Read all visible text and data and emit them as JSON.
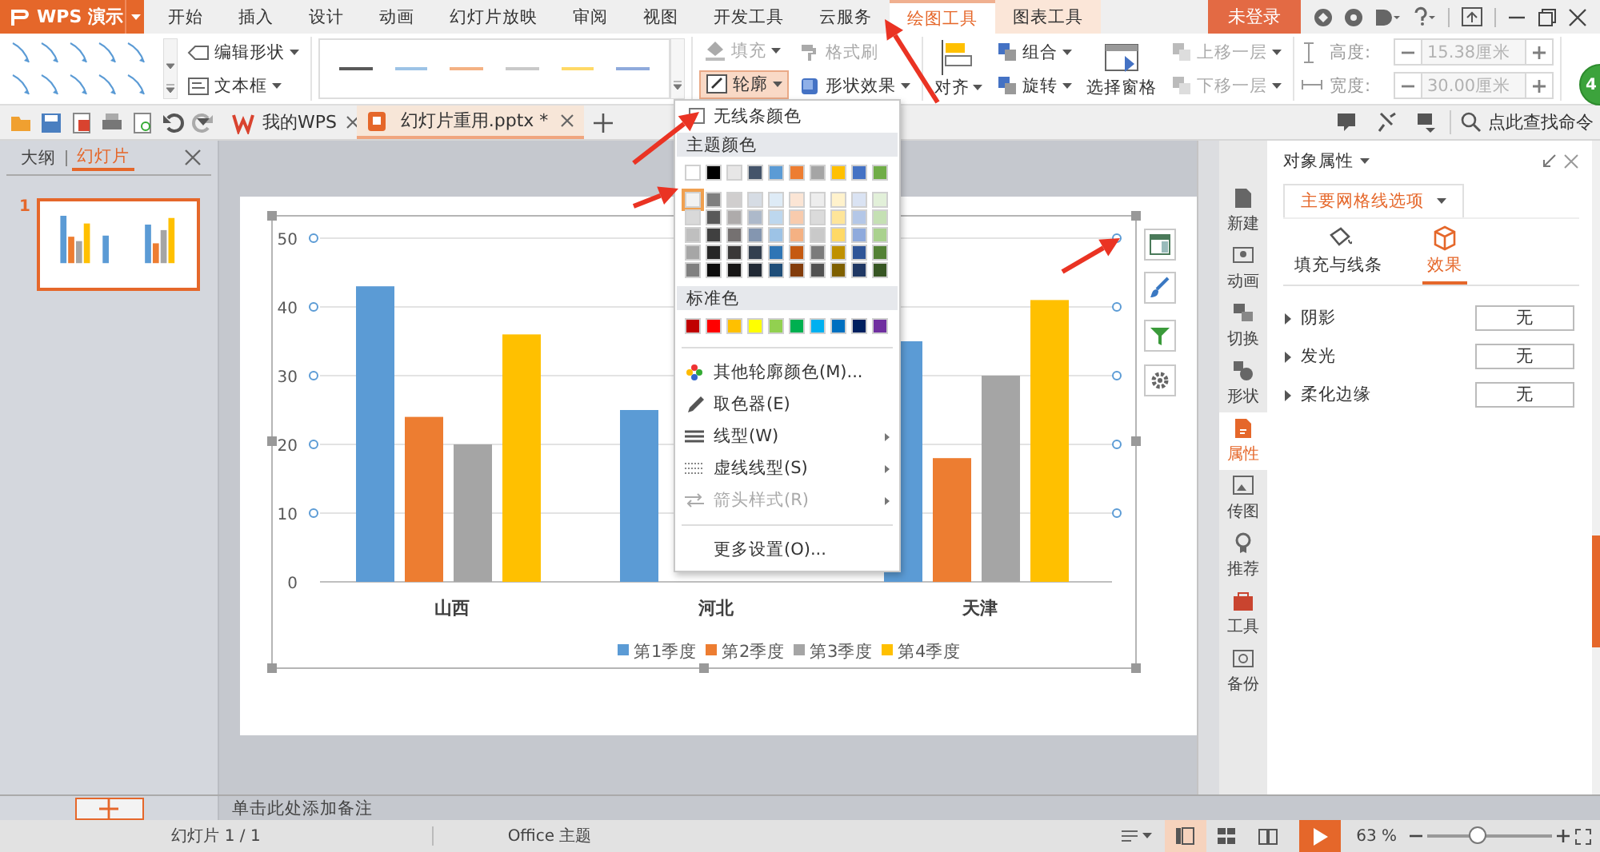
{
  "app": {
    "logo": "WPS 演示"
  },
  "menu_tabs": [
    {
      "label": "开始",
      "selected": false,
      "kind": "normal"
    },
    {
      "label": "插入",
      "selected": false,
      "kind": "normal"
    },
    {
      "label": "设计",
      "selected": false,
      "kind": "normal"
    },
    {
      "label": "动画",
      "selected": false,
      "kind": "normal"
    },
    {
      "label": "幻灯片放映",
      "selected": false,
      "kind": "normal"
    },
    {
      "label": "审阅",
      "selected": false,
      "kind": "normal"
    },
    {
      "label": "视图",
      "selected": false,
      "kind": "normal"
    },
    {
      "label": "开发工具",
      "selected": false,
      "kind": "normal"
    },
    {
      "label": "云服务",
      "selected": false,
      "kind": "normal"
    },
    {
      "label": "绘图工具",
      "selected": true,
      "kind": "context"
    },
    {
      "label": "图表工具",
      "selected": false,
      "kind": "context"
    }
  ],
  "login": "未登录",
  "badge": "4",
  "ribbon": {
    "shape_tools": [
      {
        "label": "编辑形状"
      },
      {
        "label": "文本框"
      }
    ],
    "line_styles": [
      {
        "color": "#595959"
      },
      {
        "color": "#9dc3e6"
      },
      {
        "color": "#f4b183"
      },
      {
        "color": "#c9c9c9"
      },
      {
        "color": "#ffd966"
      },
      {
        "color": "#8faadc"
      }
    ],
    "format": [
      {
        "label": "填充",
        "disabled": true,
        "expanded": false
      },
      {
        "label": "格式刷",
        "disabled": true,
        "expanded": false
      },
      {
        "label": "轮廓",
        "disabled": false,
        "expanded": true
      },
      {
        "label": "形状效果",
        "disabled": false,
        "expanded": false
      }
    ],
    "arrange": [
      {
        "kind": "large",
        "label": "对齐"
      },
      {
        "kind": "small",
        "label": "组合",
        "disabled": false
      },
      {
        "kind": "small",
        "label": "旋转",
        "disabled": false
      },
      {
        "kind": "large",
        "label": "选择窗格"
      },
      {
        "kind": "small",
        "label": "上移一层",
        "disabled": true
      },
      {
        "kind": "small",
        "label": "下移一层",
        "disabled": true
      }
    ],
    "size": [
      {
        "label": "高度:",
        "value": "15.38厘米",
        "disabled": true
      },
      {
        "label": "宽度:",
        "value": "30.00厘米",
        "disabled": true
      }
    ]
  },
  "doc_tabs": [
    {
      "label": "我的WPS",
      "selected": false
    },
    {
      "label": "幻灯片重用.pptx *",
      "selected": true
    }
  ],
  "command_search": "点此查找命令",
  "slide_panel": {
    "tabs": [
      {
        "label": "大纲",
        "selected": false
      },
      {
        "label": "幻灯片",
        "selected": true
      }
    ],
    "slides": [
      {
        "number": "1",
        "selected": true
      }
    ]
  },
  "chart_data": {
    "type": "bar",
    "categories": [
      "山西",
      "河北",
      "天津"
    ],
    "ylim": [
      0,
      50
    ],
    "yticks": [
      0,
      10,
      20,
      30,
      40,
      50
    ],
    "grid": true,
    "legend": true,
    "series": [
      {
        "name": "第1季度",
        "color": "#5b9bd5",
        "values": [
          43,
          25,
          35
        ]
      },
      {
        "name": "第2季度",
        "color": "#ed7d31",
        "values": [
          24,
          null,
          18
        ]
      },
      {
        "name": "第3季度",
        "color": "#a5a5a5",
        "values": [
          20,
          null,
          30
        ]
      },
      {
        "name": "第4季度",
        "color": "#ffc000",
        "values": [
          36,
          null,
          41
        ]
      }
    ]
  },
  "outline_menu": {
    "no_color": "无线条颜色",
    "theme_title": "主题颜色",
    "standard_title": "标准色",
    "theme_colors": [
      {
        "color": "#ffffff",
        "selected": false,
        "shades": [
          {
            "color": "#f2f2f2",
            "selected": true
          },
          {
            "color": "#d9d9d9",
            "selected": false
          },
          {
            "color": "#bfbfbf",
            "selected": false
          },
          {
            "color": "#a6a6a6",
            "selected": false
          },
          {
            "color": "#808080",
            "selected": false
          }
        ]
      },
      {
        "color": "#000000",
        "selected": false,
        "shades": [
          {
            "color": "#7f7f7f",
            "selected": false
          },
          {
            "color": "#595959",
            "selected": false
          },
          {
            "color": "#404040",
            "selected": false
          },
          {
            "color": "#262626",
            "selected": false
          },
          {
            "color": "#0d0d0d",
            "selected": false
          }
        ]
      },
      {
        "color": "#e7e6e6",
        "selected": false,
        "shades": [
          {
            "color": "#d0cece",
            "selected": false
          },
          {
            "color": "#aeabab",
            "selected": false
          },
          {
            "color": "#757171",
            "selected": false
          },
          {
            "color": "#3a3838",
            "selected": false
          },
          {
            "color": "#171616",
            "selected": false
          }
        ]
      },
      {
        "color": "#44546a",
        "selected": false,
        "shades": [
          {
            "color": "#d6dce4",
            "selected": false
          },
          {
            "color": "#adb9ca",
            "selected": false
          },
          {
            "color": "#8496b0",
            "selected": false
          },
          {
            "color": "#333f4f",
            "selected": false
          },
          {
            "color": "#222a35",
            "selected": false
          }
        ]
      },
      {
        "color": "#5b9bd5",
        "selected": false,
        "shades": [
          {
            "color": "#deebf6",
            "selected": false
          },
          {
            "color": "#bdd7ee",
            "selected": false
          },
          {
            "color": "#9dc3e6",
            "selected": false
          },
          {
            "color": "#2e75b5",
            "selected": false
          },
          {
            "color": "#1f4e79",
            "selected": false
          }
        ]
      },
      {
        "color": "#ed7d31",
        "selected": false,
        "shades": [
          {
            "color": "#fbe5d5",
            "selected": false
          },
          {
            "color": "#f8cbad",
            "selected": false
          },
          {
            "color": "#f4b183",
            "selected": false
          },
          {
            "color": "#c55a11",
            "selected": false
          },
          {
            "color": "#833c0b",
            "selected": false
          }
        ]
      },
      {
        "color": "#a5a5a5",
        "selected": false,
        "shades": [
          {
            "color": "#ededed",
            "selected": false
          },
          {
            "color": "#dbdbdb",
            "selected": false
          },
          {
            "color": "#c9c9c9",
            "selected": false
          },
          {
            "color": "#7b7b7b",
            "selected": false
          },
          {
            "color": "#525252",
            "selected": false
          }
        ]
      },
      {
        "color": "#ffc000",
        "selected": false,
        "shades": [
          {
            "color": "#fff2cc",
            "selected": false
          },
          {
            "color": "#fee599",
            "selected": false
          },
          {
            "color": "#ffd966",
            "selected": false
          },
          {
            "color": "#bf9000",
            "selected": false
          },
          {
            "color": "#7f6000",
            "selected": false
          }
        ]
      },
      {
        "color": "#4472c4",
        "selected": false,
        "shades": [
          {
            "color": "#dae3f3",
            "selected": false
          },
          {
            "color": "#b4c7e7",
            "selected": false
          },
          {
            "color": "#8faadc",
            "selected": false
          },
          {
            "color": "#2f5597",
            "selected": false
          },
          {
            "color": "#203864",
            "selected": false
          }
        ]
      },
      {
        "color": "#70ad47",
        "selected": false,
        "shades": [
          {
            "color": "#e2f0d9",
            "selected": false
          },
          {
            "color": "#c5e0b4",
            "selected": false
          },
          {
            "color": "#a9d18e",
            "selected": false
          },
          {
            "color": "#538135",
            "selected": false
          },
          {
            "color": "#375623",
            "selected": false
          }
        ]
      }
    ],
    "standard_colors": [
      {
        "color": "#c00000",
        "selected": false
      },
      {
        "color": "#ff0000",
        "selected": false
      },
      {
        "color": "#ffc000",
        "selected": false
      },
      {
        "color": "#ffff00",
        "selected": false
      },
      {
        "color": "#92d050",
        "selected": false
      },
      {
        "color": "#00b050",
        "selected": false
      },
      {
        "color": "#00b0f0",
        "selected": false
      },
      {
        "color": "#0070c0",
        "selected": false
      },
      {
        "color": "#002060",
        "selected": false
      },
      {
        "color": "#7030a0",
        "selected": false
      }
    ],
    "items": [
      {
        "kind": "palette",
        "label": "其他轮廓颜色(M)...",
        "submenu": false,
        "disabled": false
      },
      {
        "kind": "eyedropper",
        "label": "取色器(E)",
        "submenu": false,
        "disabled": false
      },
      {
        "kind": "lines",
        "label": "线型(W)",
        "submenu": true,
        "disabled": false
      },
      {
        "kind": "dashes",
        "label": "虚线线型(S)",
        "submenu": true,
        "disabled": false
      },
      {
        "kind": "arrows",
        "label": "箭头样式(R)",
        "submenu": true,
        "disabled": true
      },
      {
        "kind": "plain",
        "label": "更多设置(O)...",
        "submenu": false,
        "disabled": false
      }
    ]
  },
  "side_strip": [
    {
      "label": "新建",
      "selected": false
    },
    {
      "label": "动画",
      "selected": false
    },
    {
      "label": "切换",
      "selected": false
    },
    {
      "label": "形状",
      "selected": false
    },
    {
      "label": "属性",
      "selected": true
    },
    {
      "label": "传图",
      "selected": false
    },
    {
      "label": "推荐",
      "selected": false
    },
    {
      "label": "工具",
      "selected": false
    },
    {
      "label": "备份",
      "selected": false
    }
  ],
  "properties": {
    "title": "对象属性",
    "section": "主要网格线选项",
    "tabs": [
      {
        "label": "填充与线条",
        "selected": false
      },
      {
        "label": "效果",
        "selected": true
      }
    ],
    "rows": [
      {
        "label": "阴影",
        "value": "无",
        "expanded": false
      },
      {
        "label": "发光",
        "value": "无",
        "expanded": false
      },
      {
        "label": "柔化边缘",
        "value": "无",
        "expanded": false
      }
    ]
  },
  "notes_placeholder": "单击此处添加备注",
  "status_bar": {
    "slide": "幻灯片 1 / 1",
    "theme": "Office 主题",
    "views": [
      {
        "selected": true
      },
      {
        "selected": false
      },
      {
        "selected": false
      }
    ],
    "zoom": "63 %",
    "zoom_slider": {
      "level": 0.4
    }
  }
}
